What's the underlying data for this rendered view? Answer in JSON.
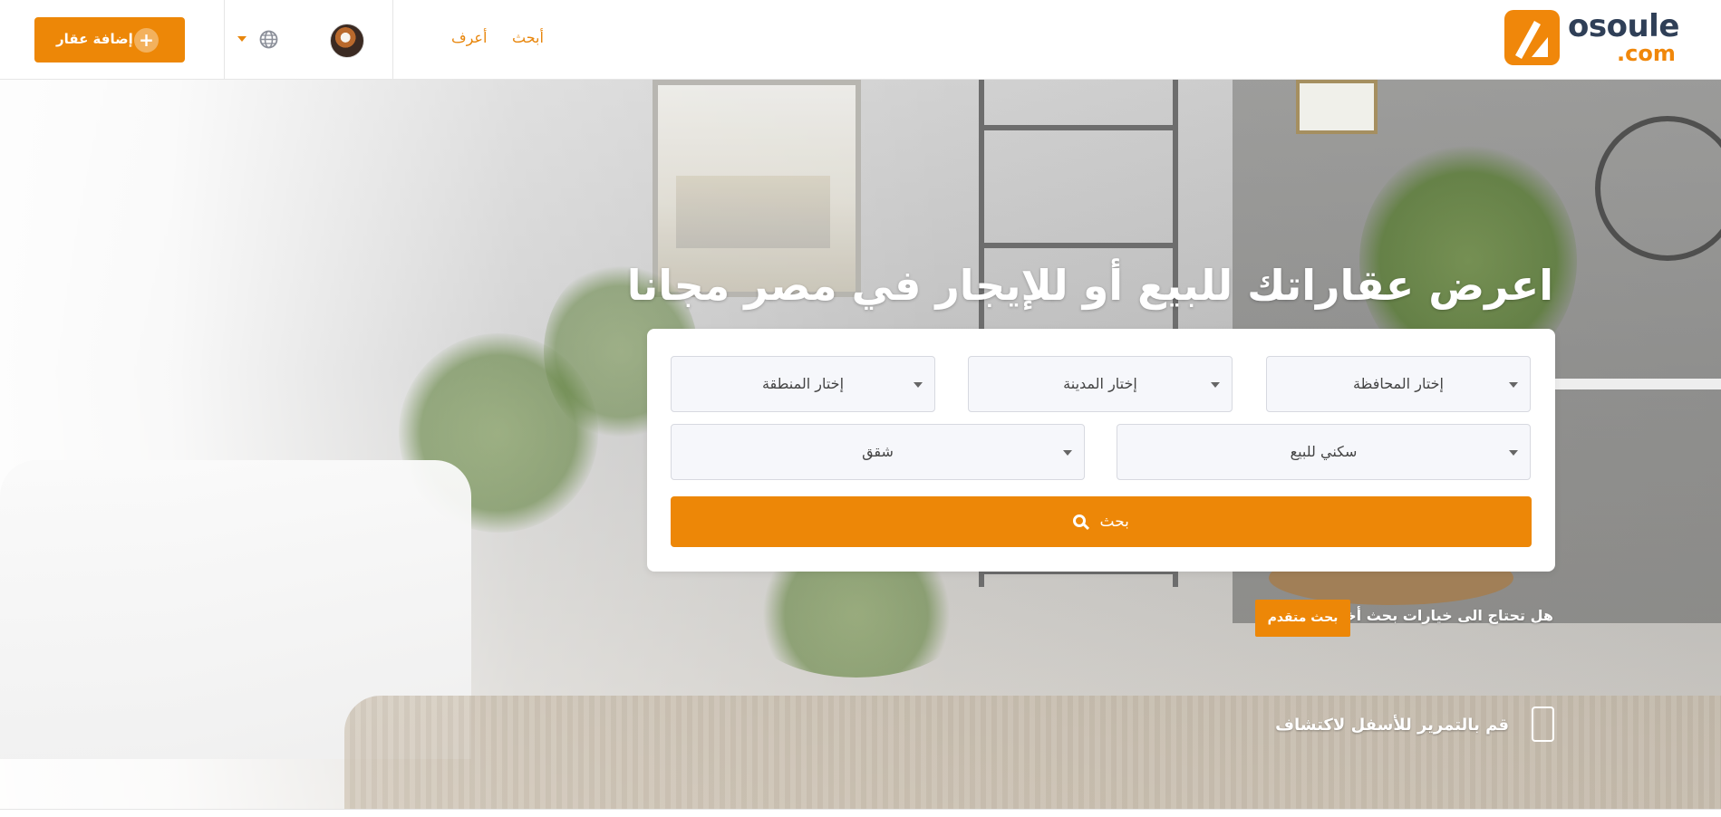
{
  "brand": {
    "name": "osoule",
    "tld": ".com",
    "accent_color": "#ed8707",
    "text_color": "#2f3f57"
  },
  "nav": {
    "search_link": "أبحث",
    "learn_link": "أعرف",
    "language_icon": "globe-icon",
    "add_property_button": "إضافة عقار",
    "add_icon": "plus-icon"
  },
  "hero": {
    "title": "اعرض عقاراتك للبيع أو للإيجار في مصر مجانا",
    "search": {
      "governorate": "إختار المحافظة",
      "city": "إختار المدينة",
      "area": "إختار المنطقة",
      "purpose": "سكني للبيع",
      "unit_type": "شقق",
      "button": "بحث"
    },
    "advanced_question": "هل تحتاج الى خيارات بحث أخرى",
    "advanced_button": "بحث متقدم",
    "scroll_hint": "قم بالتمرير للأسفل لاكتشاف"
  }
}
